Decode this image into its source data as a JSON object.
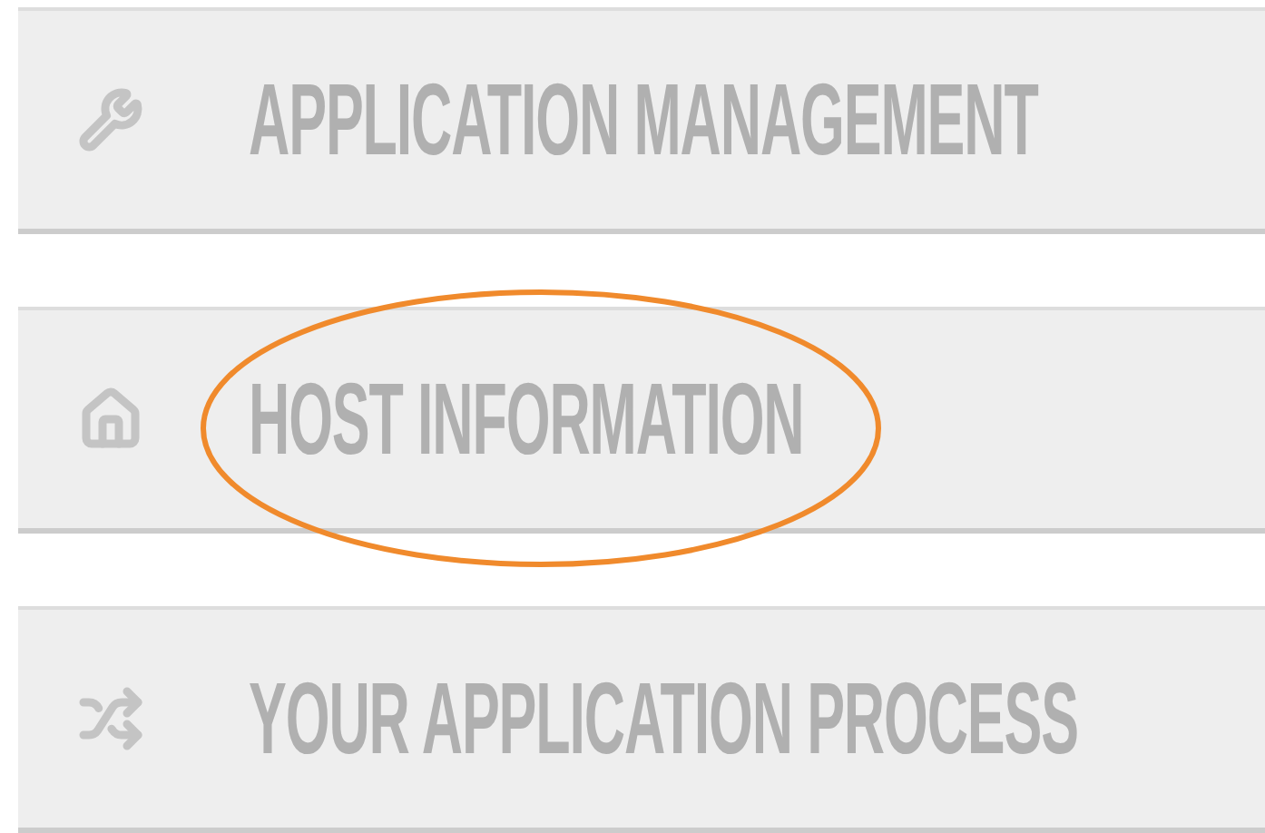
{
  "menu_items": [
    {
      "kind": "wrench",
      "label": "APPLICATION MANAGEMENT",
      "circled": false
    },
    {
      "kind": "home",
      "label": "HOST INFORMATION",
      "circled": true
    },
    {
      "kind": "shuffle",
      "label": "YOUR APPLICATION PROCESS",
      "circled": false
    }
  ]
}
